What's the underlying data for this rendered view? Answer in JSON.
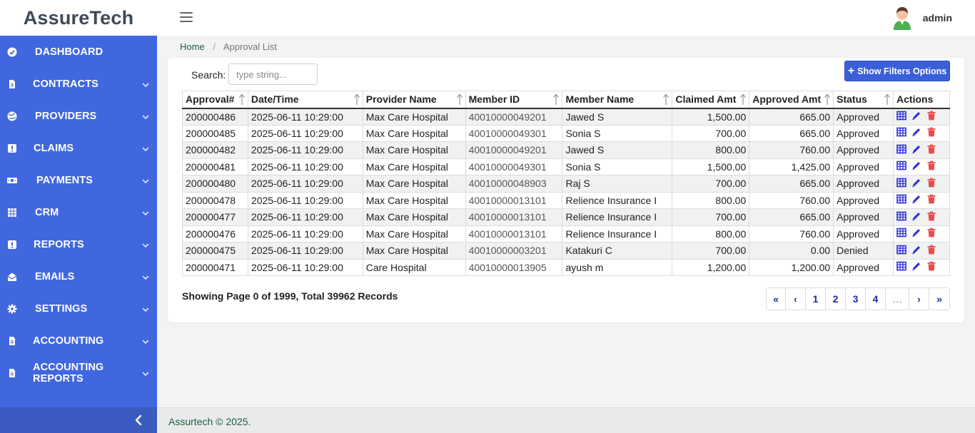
{
  "brand": "AssureTech",
  "user": {
    "name": "admin"
  },
  "sidebar": {
    "items": [
      {
        "label": "DASHBOARD",
        "icon": "dashboard-icon",
        "chevron": false
      },
      {
        "label": "CONTRACTS",
        "icon": "file-icon",
        "chevron": true
      },
      {
        "label": "PROVIDERS",
        "icon": "globe-icon",
        "chevron": true
      },
      {
        "label": "CLAIMS",
        "icon": "alert-icon",
        "chevron": true
      },
      {
        "label": "PAYMENTS",
        "icon": "money-icon",
        "chevron": true
      },
      {
        "label": "CRM",
        "icon": "grid-icon",
        "chevron": true
      },
      {
        "label": "REPORTS",
        "icon": "alert-icon",
        "chevron": true
      },
      {
        "label": "EMAILS",
        "icon": "envelope-open-icon",
        "chevron": true
      },
      {
        "label": "SETTINGS",
        "icon": "gear-icon",
        "chevron": true
      },
      {
        "label": "ACCOUNTING",
        "icon": "file-icon",
        "chevron": true
      },
      {
        "label": "ACCOUNTING REPORTS",
        "icon": "file-icon",
        "chevron": true
      }
    ]
  },
  "breadcrumb": {
    "home": "Home",
    "current": "Approval List"
  },
  "search": {
    "label": "Search:",
    "placeholder": "type string...",
    "value": ""
  },
  "filters_button": "Show Filters Options",
  "table": {
    "columns": [
      "Approval#",
      "Date/Time",
      "Provider Name",
      "Member ID",
      "Member Name",
      "Claimed Amt",
      "Approved Amt",
      "Status",
      "Actions"
    ],
    "rows": [
      [
        "200000486",
        "2025-06-11 10:29:00",
        "Max Care Hospital",
        "40010000049201",
        "Jawed S",
        "1,500.00",
        "665.00",
        "Approved"
      ],
      [
        "200000485",
        "2025-06-11 10:29:00",
        "Max Care Hospital",
        "40010000049301",
        "Sonia S",
        "700.00",
        "665.00",
        "Approved"
      ],
      [
        "200000482",
        "2025-06-11 10:29:00",
        "Max Care Hospital",
        "40010000049201",
        "Jawed S",
        "800.00",
        "760.00",
        "Approved"
      ],
      [
        "200000481",
        "2025-06-11 10:29:00",
        "Max Care Hospital",
        "40010000049301",
        "Sonia S",
        "1,500.00",
        "1,425.00",
        "Approved"
      ],
      [
        "200000480",
        "2025-06-11 10:29:00",
        "Max Care Hospital",
        "40010000048903",
        "Raj S",
        "700.00",
        "665.00",
        "Approved"
      ],
      [
        "200000478",
        "2025-06-11 10:29:00",
        "Max Care Hospital",
        "40010000013101",
        "Relience Insurance I",
        "800.00",
        "760.00",
        "Approved"
      ],
      [
        "200000477",
        "2025-06-11 10:29:00",
        "Max Care Hospital",
        "40010000013101",
        "Relience Insurance I",
        "700.00",
        "665.00",
        "Approved"
      ],
      [
        "200000476",
        "2025-06-11 10:29:00",
        "Max Care Hospital",
        "40010000013101",
        "Relience Insurance I",
        "800.00",
        "760.00",
        "Approved"
      ],
      [
        "200000475",
        "2025-06-11 10:29:00",
        "Max Care Hospital",
        "40010000003201",
        "Katakuri C",
        "700.00",
        "0.00",
        "Denied"
      ],
      [
        "200000471",
        "2025-06-11 10:29:00",
        "Care Hospital",
        "40010000013905",
        "ayush m",
        "1,200.00",
        "1,200.00",
        "Approved"
      ]
    ],
    "row_actions": [
      "grid-icon",
      "pencil-icon",
      "trash-icon"
    ]
  },
  "summary": "Showing Page 0 of 1999, Total 39962 Records",
  "pagination": [
    "«",
    "‹",
    "1",
    "2",
    "3",
    "4",
    "…",
    "›",
    "»"
  ],
  "footer": "Assurtech © 2025.",
  "colors": {
    "sidebar": "#4167df",
    "primary_button": "#3b5fd9",
    "action_view": "#2b2ee0",
    "action_edit": "#2b2ee0",
    "action_delete": "#e84c4c",
    "link_green": "#1e5e3a"
  }
}
